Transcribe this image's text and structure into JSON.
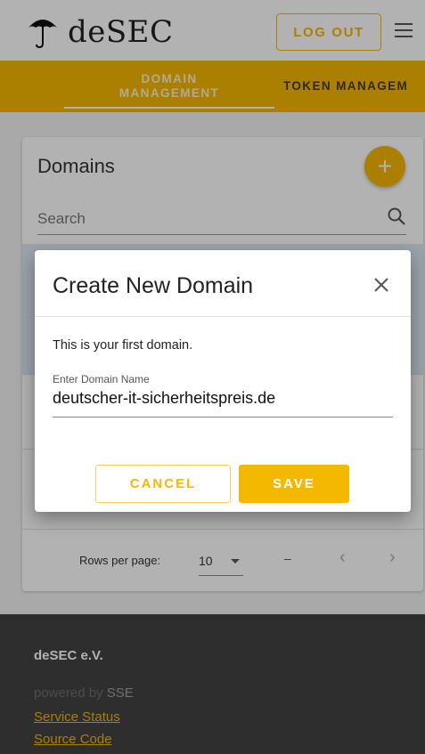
{
  "header": {
    "logo_text": "deSEC",
    "logout_label": "LOG OUT"
  },
  "tabs": [
    {
      "label_line1": "DOMAIN",
      "label_line2": "MANAGEMENT",
      "active": true
    },
    {
      "label": "TOKEN MANAGEM",
      "active": false
    }
  ],
  "domains_card": {
    "title": "Domains",
    "add_symbol": "+",
    "search_placeholder": "Search",
    "rows_per_page_label": "Rows per page:",
    "rows_per_page_value": "10",
    "range_text": "–",
    "prev_symbol": "‹",
    "next_symbol": "›"
  },
  "dialog": {
    "title": "Create New Domain",
    "message": "This is your first domain.",
    "field_label": "Enter Domain Name",
    "field_value": "deutscher-it-sicherheitspreis.de",
    "cancel_label": "CANCEL",
    "save_label": "SAVE"
  },
  "footer": {
    "org": "deSEC e.V.",
    "powered_by": "powered by ",
    "powered_by_name": "SSE",
    "link_status": "Service Status",
    "link_source": "Source Code"
  },
  "colors": {
    "accent": "#f5b800",
    "footer_bg": "#424242"
  }
}
